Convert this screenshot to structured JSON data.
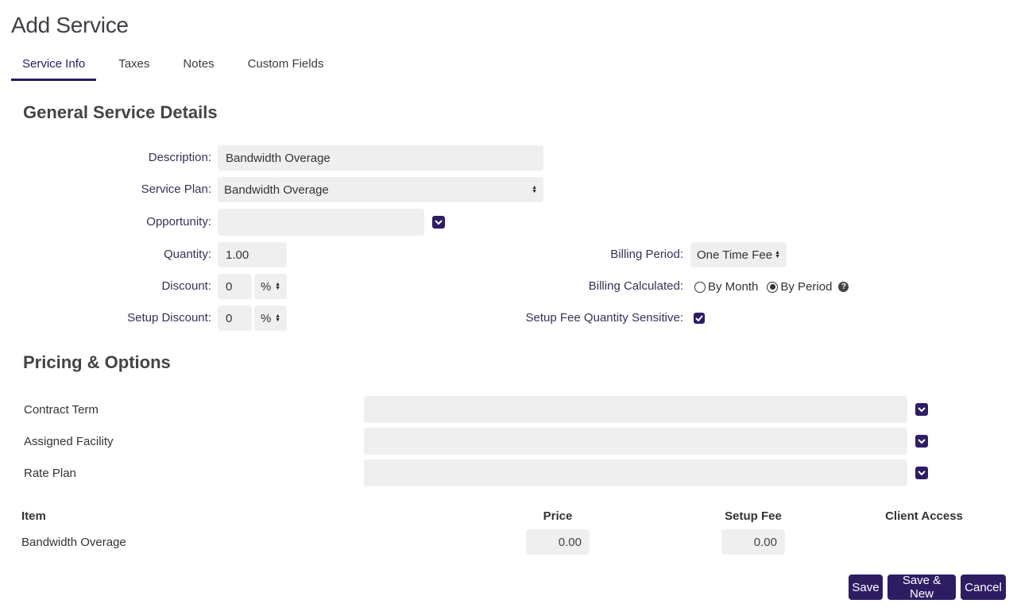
{
  "page": {
    "title": "Add Service"
  },
  "tabs": [
    {
      "label": "Service Info"
    },
    {
      "label": "Taxes"
    },
    {
      "label": "Notes"
    },
    {
      "label": "Custom Fields"
    }
  ],
  "general": {
    "title": "General Service Details",
    "description": {
      "label": "Description:",
      "value": "Bandwidth Overage"
    },
    "service_plan": {
      "label": "Service Plan:",
      "value": "Bandwidth Overage"
    },
    "opportunity": {
      "label": "Opportunity:",
      "value": ""
    },
    "quantity": {
      "label": "Quantity:",
      "value": "1.00"
    },
    "discount": {
      "label": "Discount:",
      "value": "0",
      "unit": "%"
    },
    "setup_discount": {
      "label": "Setup Discount:",
      "value": "0",
      "unit": "%"
    },
    "billing_period": {
      "label": "Billing Period:",
      "value": "One Time Fee"
    },
    "billing_calculated": {
      "label": "Billing Calculated:",
      "options": [
        "By Month",
        "By Period"
      ],
      "selected": "By Period"
    },
    "setup_fee_qty": {
      "label": "Setup Fee Quantity Sensitive:",
      "checked": true
    }
  },
  "pricing": {
    "title": "Pricing & Options",
    "contract_term": {
      "label": "Contract Term"
    },
    "assigned_facility": {
      "label": "Assigned Facility"
    },
    "rate_plan": {
      "label": "Rate Plan"
    },
    "table": {
      "headers": [
        "Item",
        "Price",
        "Setup Fee",
        "Client Access"
      ],
      "rows": [
        {
          "item": "Bandwidth Overage",
          "price": "0.00",
          "setup_fee": "0.00"
        }
      ]
    }
  },
  "actions": {
    "save": "Save",
    "save_new": "Save & New",
    "cancel": "Cancel"
  },
  "colors": {
    "accent": "#2f1d63",
    "field_bg": "#efefef"
  },
  "icons": {
    "checkbox": "check-icon",
    "dropdown": "chevron-down-icon",
    "help": "question-icon"
  }
}
